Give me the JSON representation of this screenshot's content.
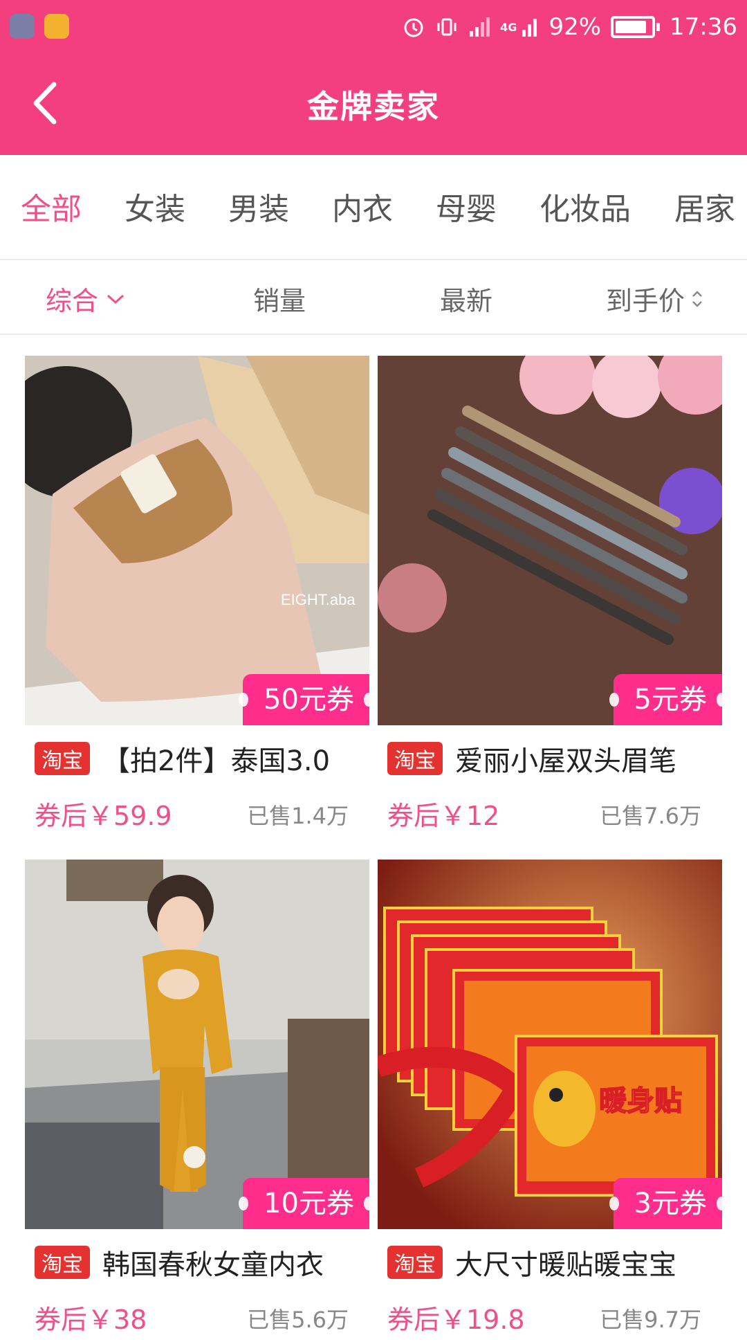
{
  "status_bar": {
    "battery": "92%",
    "time": "17:36",
    "network": "4G"
  },
  "header": {
    "title": "金牌卖家"
  },
  "categories": [
    "全部",
    "女装",
    "男装",
    "内衣",
    "母婴",
    "化妆品",
    "居家"
  ],
  "sort": [
    "综合",
    "销量",
    "最新",
    "到手价"
  ],
  "products": [
    {
      "platform": "淘宝",
      "title": "【拍2件】泰国3.0",
      "price": "券后￥59.9",
      "sold": "已售1.4万",
      "coupon": "50元券",
      "image_text": "EIGHT.aba"
    },
    {
      "platform": "淘宝",
      "title": "爱丽小屋双头眉笔",
      "price": "券后￥12",
      "sold": "已售7.6万",
      "coupon": "5元券"
    },
    {
      "platform": "淘宝",
      "title": "韩国春秋女童内衣",
      "price": "券后￥38",
      "sold": "已售5.6万",
      "coupon": "10元券"
    },
    {
      "platform": "淘宝",
      "title": "大尺寸暖贴暖宝宝",
      "price": "券后￥19.8",
      "sold": "已售9.7万",
      "coupon": "3元券",
      "image_text": "暖身贴"
    }
  ],
  "colors": {
    "brand": "#f43f7f",
    "accent_text": "#f0508a",
    "coupon": "#ff2d8b",
    "taobao_badge": "#e3322f"
  }
}
